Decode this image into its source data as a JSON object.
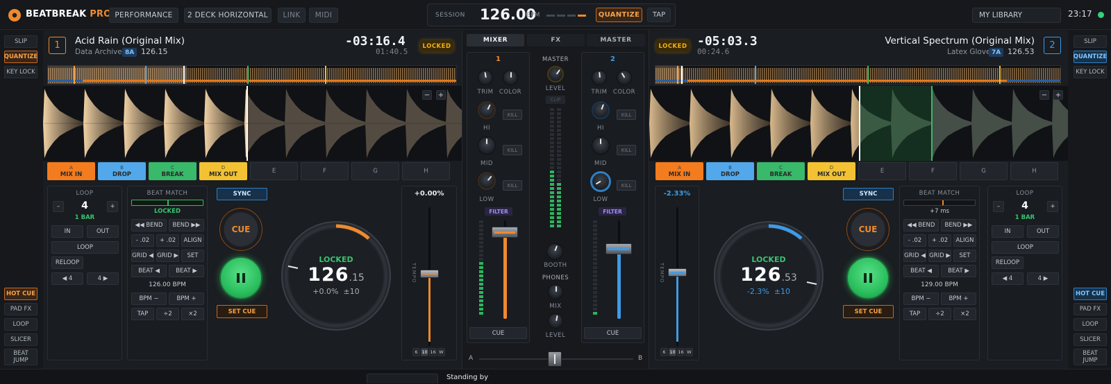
{
  "app": {
    "brand": "BEATBREAK",
    "brand_suffix": "PRO"
  },
  "topbar": {
    "performance": "PERFORMANCE",
    "layout": "2 DECK HORIZONTAL",
    "link": "LINK",
    "midi": "MIDI",
    "session_label": "SESSION",
    "session_bpm": "126.00",
    "bpm_unit": "BPM",
    "quantize": "QUANTIZE",
    "tap": "TAP",
    "library": "MY LIBRARY",
    "clock": "23:17"
  },
  "left_side": {
    "slip": "SLIP",
    "quantize": "QUANTIZE",
    "keylock": "KEY LOCK",
    "modes": [
      "HOT CUE",
      "PAD FX",
      "LOOP",
      "SLICER",
      "BEAT JUMP"
    ]
  },
  "right_side": {
    "slip": "SLIP",
    "quantize": "QUANTIZE",
    "keylock": "KEY LOCK",
    "modes": [
      "HOT CUE",
      "PAD FX",
      "LOOP",
      "SLICER",
      "BEAT JUMP"
    ]
  },
  "deck1": {
    "number": "1",
    "title": "Acid Rain (Original Mix)",
    "artist": "Data Archive",
    "key": "8A",
    "bpm": "126.15",
    "remaining": "-03:16.4",
    "elapsed": "01:40.5",
    "locked": "LOCKED",
    "cues": [
      {
        "letter": "A",
        "label": "MIX IN"
      },
      {
        "letter": "B",
        "label": "DROP"
      },
      {
        "letter": "C",
        "label": "BREAK"
      },
      {
        "letter": "D",
        "label": "MIX OUT"
      },
      {
        "letter": "E"
      },
      {
        "letter": "F"
      },
      {
        "letter": "G"
      },
      {
        "letter": "H"
      }
    ],
    "loop": {
      "title": "LOOP",
      "value": "4",
      "sub": "1 BAR",
      "minus": "–",
      "plus": "+",
      "in": "IN",
      "out": "OUT",
      "loop": "LOOP",
      "reloop": "RELOOP",
      "back": "◀ 4",
      "fwd": "4 ▶"
    },
    "beatmatch": {
      "title": "BEAT MATCH",
      "status": "LOCKED",
      "bend_l": "◀◀ BEND",
      "bend_r": "BEND ▶▶",
      "nudge_m": "- .02",
      "nudge_p": "+ .02",
      "align": "ALIGN",
      "grid_l": "GRID ◀",
      "grid_r": "GRID ▶",
      "set": "SET",
      "beat_l": "BEAT ◀",
      "beat_r": "BEAT ▶",
      "bpm": "126.00 BPM",
      "bpm_minus": "BPM −",
      "bpm_plus": "BPM +",
      "tap": "TAP",
      "div": "÷2",
      "mul": "×2"
    },
    "sync": "SYNC",
    "cue": "CUE",
    "set_cue": "SET CUE",
    "jog": {
      "status": "LOCKED",
      "bpm_int": "126",
      "bpm_dec": ".15",
      "pitch": "+0.0%",
      "range": "±10"
    },
    "tempo": {
      "value": "+0.00%",
      "label": "TEMPO",
      "ranges": [
        "6",
        "10",
        "16",
        "W"
      ]
    }
  },
  "deck2": {
    "number": "2",
    "title": "Vertical Spectrum (Original Mix)",
    "artist": "Latex Gloves",
    "key": "7A",
    "bpm": "126.53",
    "remaining": "-05:03.3",
    "elapsed": "00:24.6",
    "locked": "LOCKED",
    "cues": [
      {
        "letter": "A",
        "label": "MIX IN"
      },
      {
        "letter": "B",
        "label": "DROP"
      },
      {
        "letter": "C",
        "label": "BREAK"
      },
      {
        "letter": "D",
        "label": "MIX OUT"
      },
      {
        "letter": "E"
      },
      {
        "letter": "F"
      },
      {
        "letter": "G"
      },
      {
        "letter": "H"
      }
    ],
    "loop": {
      "title": "LOOP",
      "value": "4",
      "sub": "1 BAR",
      "minus": "–",
      "plus": "+",
      "in": "IN",
      "out": "OUT",
      "loop": "LOOP",
      "reloop": "RELOOP",
      "back": "◀ 4",
      "fwd": "4 ▶"
    },
    "beatmatch": {
      "title": "BEAT MATCH",
      "status": "+7 ms",
      "bend_l": "◀◀ BEND",
      "bend_r": "BEND ▶▶",
      "nudge_m": "- .02",
      "nudge_p": "+ .02",
      "align": "ALIGN",
      "grid_l": "GRID ◀",
      "grid_r": "GRID ▶",
      "set": "SET",
      "beat_l": "BEAT ◀",
      "beat_r": "BEAT ▶",
      "bpm": "129.00 BPM",
      "bpm_minus": "BPM −",
      "bpm_plus": "BPM +",
      "tap": "TAP",
      "div": "÷2",
      "mul": "×2"
    },
    "sync": "SYNC",
    "cue": "CUE",
    "set_cue": "SET CUE",
    "jog": {
      "status": "LOCKED",
      "bpm_int": "126",
      "bpm_dec": ".53",
      "pitch": "-2.3%",
      "range": "±10"
    },
    "tempo": {
      "value": "-2.33%",
      "label": "TEMPO",
      "ranges": [
        "6",
        "10",
        "16",
        "W"
      ]
    }
  },
  "mixer": {
    "tabs": [
      "MIXER",
      "FX",
      "MASTER"
    ],
    "ch1": "1",
    "ch2": "2",
    "trim": "TRIM",
    "color": "COLOR",
    "hi": "HI",
    "mid": "MID",
    "low": "LOW",
    "kill": "KILL",
    "filter": "FILTER",
    "cue": "CUE",
    "master": "MASTER",
    "level": "LEVEL",
    "clip": "CLIP",
    "booth": "BOOTH",
    "phones": "PHONES",
    "mix": "MIX",
    "a": "A",
    "b": "B"
  },
  "status": {
    "text": "Standing by"
  },
  "colors": {
    "accent1": "#f08a2c",
    "accent2": "#3f9be6",
    "cueA": "#f37c1e",
    "cueB": "#52a8ea",
    "cueC": "#39b96a",
    "cueD": "#f2c233",
    "locked": "#f2b21b"
  }
}
